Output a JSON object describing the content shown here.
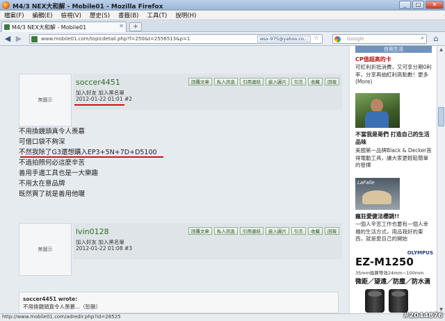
{
  "window": {
    "title": "M4/3 NEX大和解 - Mobile01 - Mozilla Firefox"
  },
  "menu": [
    "檔案(F)",
    "編輯(E)",
    "檢視(V)",
    "歷史(S)",
    "書籤(B)",
    "工具(T)",
    "說明(H)"
  ],
  "tab": {
    "label": "M4/3 NEX大和解 - Mobile01",
    "new_tab": "+"
  },
  "nav": {
    "url": "www.mobile01.com/topicdetail.php?f=250&t=2556513&p=1",
    "identity": "wsx-975@yahoo.co...",
    "search_placeholder": "Google"
  },
  "posts": [
    {
      "avatar": "無圖示",
      "username": "soccer4451",
      "links": "加入好友  加入黑名單",
      "date": "2012-01-22 01:01",
      "num": "#2",
      "lines": [
        "不用換鏡頭真令人羨慕",
        "可借口袋不夠深",
        "不然我除了G3還想購入EP3+5N+7D+D5100",
        "不過拍照何必這麼辛苦",
        "善用手邊工具也是一大樂趣",
        "不用太在意品牌",
        "既然買了就是善用他囉"
      ]
    },
    {
      "avatar": "無圖示",
      "username": "lvin0128",
      "links": "加入好友  加入黑名單",
      "date": "2012-01-22 01:08",
      "num": "#3"
    }
  ],
  "post_buttons": [
    "回覆文章",
    "私人訊息",
    "引用連結",
    "嵌入圖片",
    "引言",
    "收藏",
    "回報"
  ],
  "quote": {
    "author": "soccer4451 wrote:",
    "text": "不用換鏡頭真令人羨慕...（恕刪）"
  },
  "sidebar": {
    "header": "信用生活",
    "ad1_title": "CP值超高的卡",
    "ad1_desc": "可紅利折抵消費，又可享分期0利率，分享再抽紅利高點數！更多(More)",
    "ad2_title": "不當我是哥們 打造自己的生活品味",
    "ad2_desc": "美國第一品牌Black & Decker首得電動工具，讓大家更輕鬆簡單的發揮",
    "ad3_img_label": "LaFalle",
    "ad3_title": "瘋狂愛健法櫻調!!",
    "ad3_desc": "一個人辛苦工作也要有一個人幸福的生活方式，用品我好的東西，就是愛自己的開始",
    "olympus": "OLYMPUS",
    "model": "EZ-M1250",
    "spec": "35mm換算等效24mm~100mm",
    "tagline": "微距／望遠／防塵／防水滴"
  },
  "status": {
    "text": "http://www.mobile01.com/adredir.php?id=28525",
    "watermark": "#2044876"
  }
}
